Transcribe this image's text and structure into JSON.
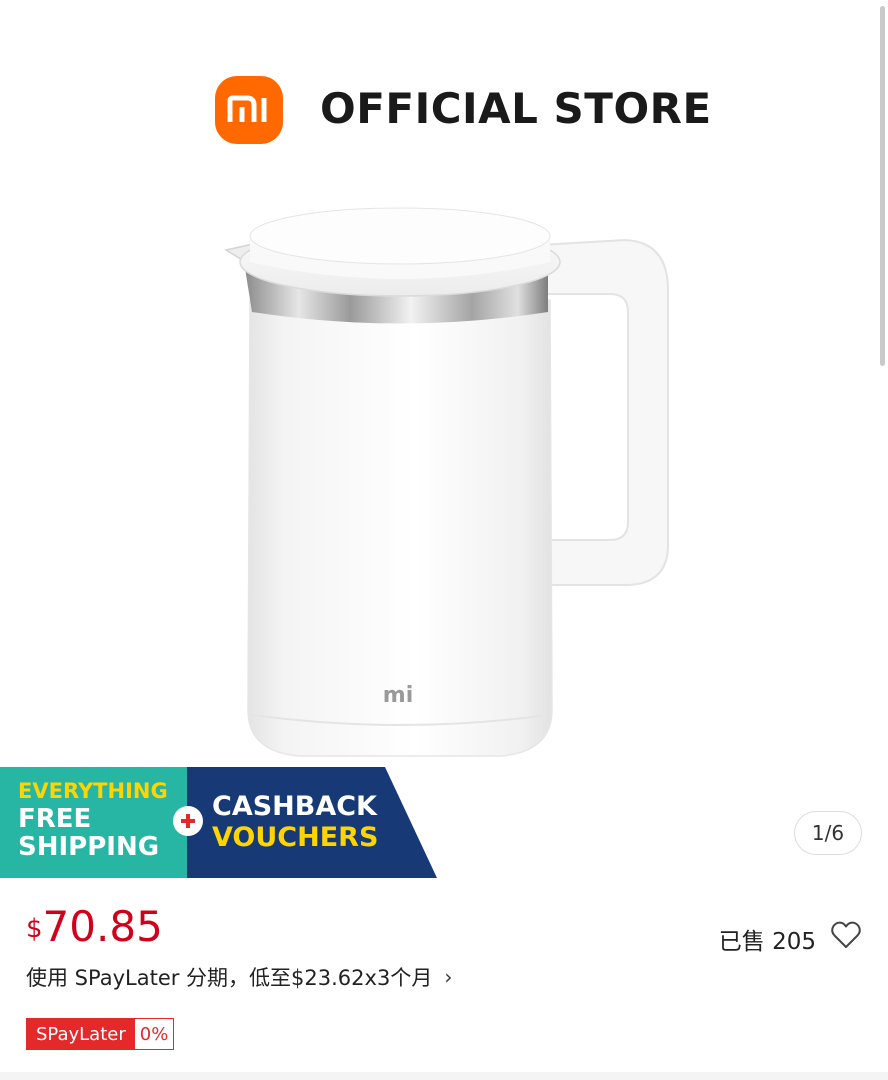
{
  "store": {
    "logo_text": "mi",
    "title": "OFFICIAL STORE"
  },
  "product_image": {
    "logo_on_kettle": "mi"
  },
  "promo": {
    "line1": "EVERYTHING",
    "line2": "FREE",
    "line3": "SHIPPING",
    "line4": "CASHBACK",
    "line5": "VOUCHERS",
    "colors": {
      "teal": "#27b6a4",
      "navy": "#173a77",
      "yellow": "#ffd400",
      "red": "#e5282a"
    }
  },
  "gallery": {
    "counter": "1/6"
  },
  "price": {
    "currency": "$",
    "amount": "70.85",
    "color": "#d0021b"
  },
  "sales": {
    "sold_text": "已售 205"
  },
  "installment": {
    "text": "使用 SPayLater 分期，低至$23.62x3个月",
    "chevron": "›"
  },
  "badge": {
    "name": "SPayLater",
    "rate": "0%"
  },
  "icons": {
    "wishlist": "heart-icon",
    "brand": "mi-logo-icon"
  },
  "brand_color": "#ff6900"
}
